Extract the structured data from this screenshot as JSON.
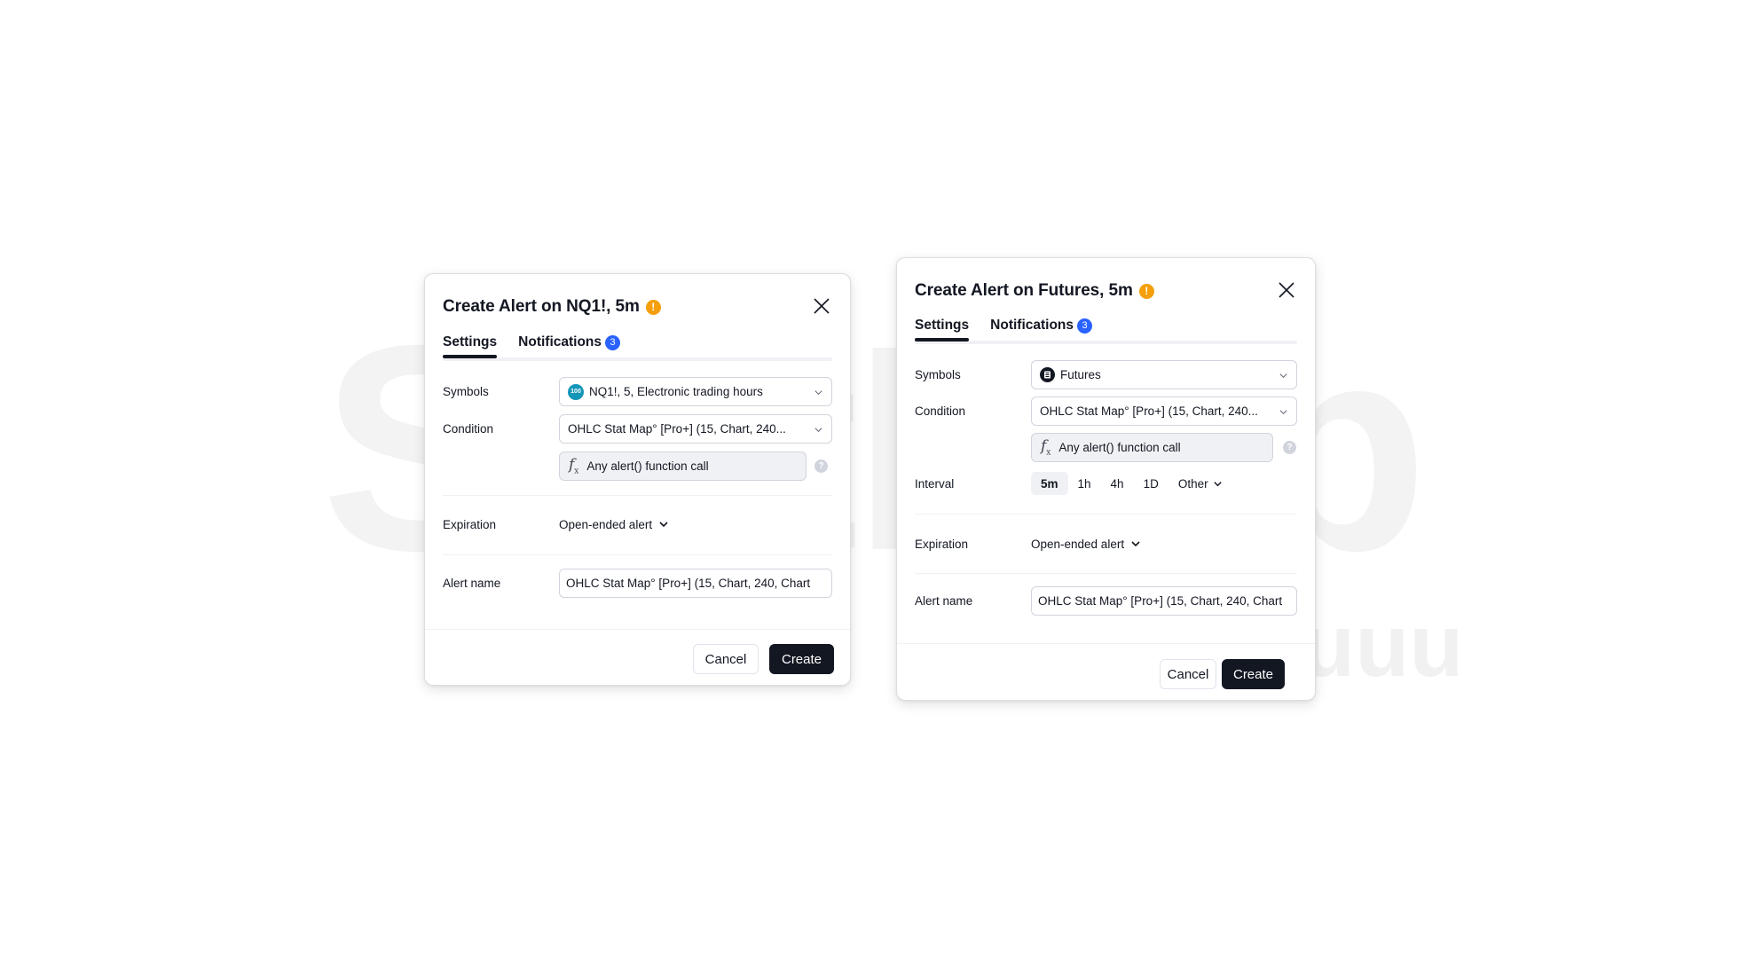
{
  "watermark": {
    "main": "StatMap",
    "sub": "_joshuuu"
  },
  "colors": {
    "accent_dark": "#131722",
    "warning": "#f59f0a",
    "badge_blue": "#2962ff",
    "nq_icon": "#1496b8"
  },
  "dialogs": [
    {
      "title": "Create Alert on NQ1!, 5m",
      "warning_icon": "exclamation-icon",
      "tabs": [
        {
          "label": "Settings",
          "active": true
        },
        {
          "label": "Notifications",
          "badge": "3"
        }
      ],
      "symbols": {
        "label": "Symbols",
        "icon": "100",
        "value": "NQ1!, 5, Electronic trading hours"
      },
      "condition": {
        "label": "Condition",
        "value": "OHLC Stat Map° [Pro+] (15, Chart, 240...",
        "function": "Any alert() function call",
        "help": "?"
      },
      "expiration": {
        "label": "Expiration",
        "value": "Open-ended alert"
      },
      "alert_name": {
        "label": "Alert name",
        "value": "OHLC Stat Map° [Pro+] (15, Chart, 240, Chart"
      },
      "buttons": {
        "cancel": "Cancel",
        "create": "Create"
      }
    },
    {
      "title": "Create Alert on Futures, 5m",
      "warning_icon": "exclamation-icon",
      "tabs": [
        {
          "label": "Settings",
          "active": true
        },
        {
          "label": "Notifications",
          "badge": "3"
        }
      ],
      "symbols": {
        "label": "Symbols",
        "value": "Futures"
      },
      "condition": {
        "label": "Condition",
        "value": "OHLC Stat Map° [Pro+] (15, Chart, 240...",
        "function": "Any alert() function call",
        "help": "?"
      },
      "interval": {
        "label": "Interval",
        "options": [
          "5m",
          "1h",
          "4h",
          "1D",
          "Other"
        ],
        "selected": "5m"
      },
      "expiration": {
        "label": "Expiration",
        "value": "Open-ended alert"
      },
      "alert_name": {
        "label": "Alert name",
        "value": "OHLC Stat Map° [Pro+] (15, Chart, 240, Chart"
      },
      "buttons": {
        "cancel": "Cancel",
        "create": "Create"
      }
    }
  ]
}
